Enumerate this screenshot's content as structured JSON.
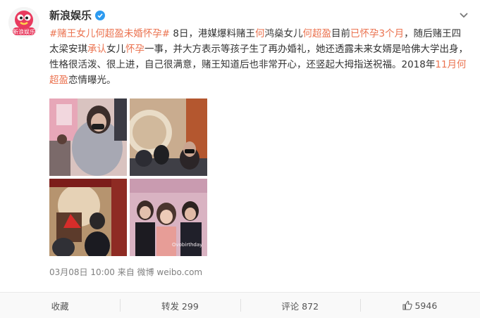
{
  "account": {
    "name": "新浪娱乐",
    "avatar_text": "新浪娱乐"
  },
  "post": {
    "segments": [
      {
        "text": "#赌王女儿",
        "link": true
      },
      {
        "text": "何超盈",
        "link": true
      },
      {
        "text": "未婚",
        "link": true
      },
      {
        "text": "怀孕#",
        "link": true
      },
      {
        "text": " 8日，港媒爆料赌王",
        "link": false
      },
      {
        "text": "何",
        "link": true
      },
      {
        "text": "鸿燊女儿",
        "link": false
      },
      {
        "text": "何超盈",
        "link": true
      },
      {
        "text": "目前",
        "link": false
      },
      {
        "text": "已怀孕3个月",
        "link": true
      },
      {
        "text": "，随后赌王四太梁安琪",
        "link": false
      },
      {
        "text": "承认",
        "link": true
      },
      {
        "text": "女儿",
        "link": false
      },
      {
        "text": "怀孕",
        "link": true
      },
      {
        "text": "一事，并大方表示等孩子生了再办婚礼，她还透露未来女婿是哈佛大学出身，性格很活泼、很上进，自己很满意，赌王知道后也非常开心，还竖起大拇指送祝福。2018年",
        "link": false
      },
      {
        "text": "11月",
        "link": true
      },
      {
        "text": "何超盈",
        "link": true
      },
      {
        "text": "恋情曝光。",
        "link": false
      }
    ],
    "meta": {
      "time": "03月08日 10:00",
      "source": "来自 微博 weibo.com"
    }
  },
  "photos": [
    {
      "alt": "photo-1"
    },
    {
      "alt": "photo-2"
    },
    {
      "alt": "photo-3"
    },
    {
      "alt": "photo-4",
      "caption": "Ovobirthday"
    }
  ],
  "actions": {
    "favorite": "收藏",
    "repost": "转发 299",
    "comment": "评论 872",
    "like": "5946"
  },
  "colors": {
    "link": "#eb7350",
    "verified": "#2d9bf0",
    "meta": "#808080"
  }
}
